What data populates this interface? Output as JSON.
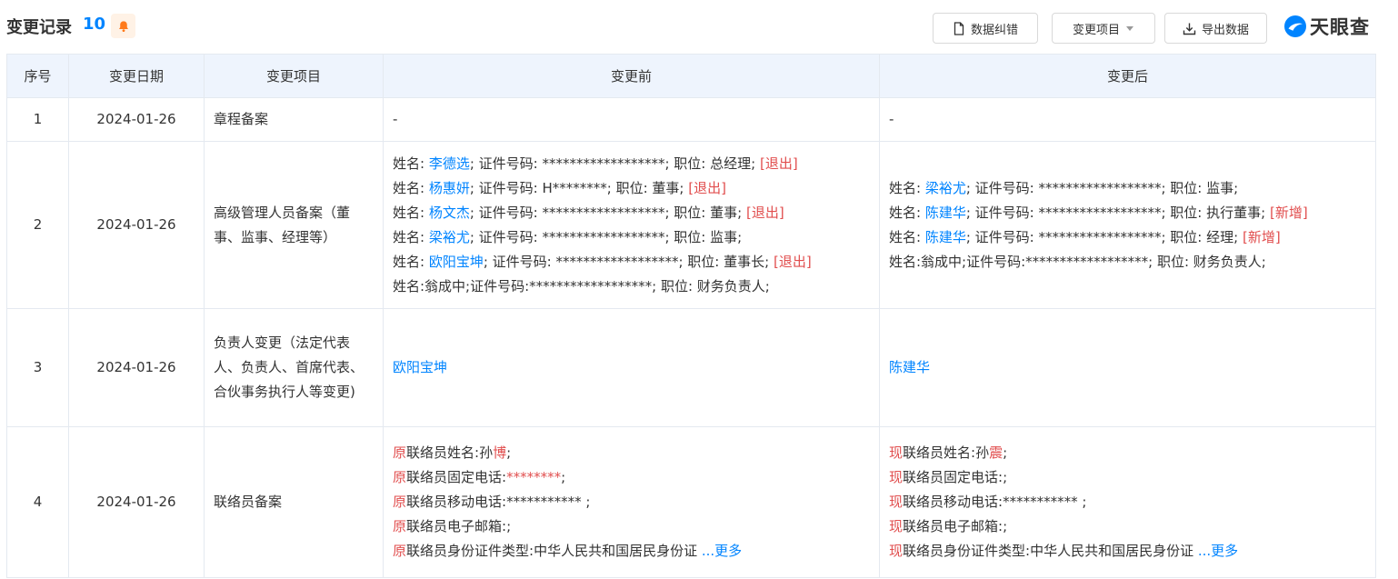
{
  "header": {
    "title": "变更记录",
    "count": "10",
    "btn_fix": "数据纠错",
    "btn_filter": "变更项目",
    "btn_export": "导出数据",
    "logo": "天眼查"
  },
  "colors": {
    "accent": "#0084ff",
    "red": "#e14e4e",
    "header_bg": "#eef4fd",
    "bell_bg": "#fff2e6",
    "bell": "#ff7a1a"
  },
  "columns": [
    "序号",
    "变更日期",
    "变更项目",
    "变更前",
    "变更后"
  ],
  "rows": [
    {
      "num": "1",
      "date": "2024-01-26",
      "item": "章程备案",
      "before": "-",
      "after": "-"
    },
    {
      "num": "2",
      "date": "2024-01-26",
      "item": "高级管理人员备案（董事、监事、经理等）",
      "before": [
        {
          "p1": "姓名: ",
          "name": "李德选",
          "p2": "; 证件号码: ******************; 职位: 总经理; ",
          "tag": "[退出]"
        },
        {
          "p1": "姓名: ",
          "name": "杨惠妍",
          "p2": "; 证件号码: H********; 职位: 董事; ",
          "tag": "[退出]"
        },
        {
          "p1": "姓名: ",
          "name": "杨文杰",
          "p2": "; 证件号码: ******************; 职位: 董事; ",
          "tag": "[退出]"
        },
        {
          "p1": "姓名: ",
          "name": "梁裕尤",
          "p2": "; 证件号码: ******************; 职位: 监事;",
          "tag": ""
        },
        {
          "p1": "姓名: ",
          "name": "欧阳宝坤",
          "p2": "; 证件号码: ******************; 职位: 董事长; ",
          "tag": "[退出]"
        },
        {
          "p1": "姓名:翁成中;证件号码:******************; 职位: 财务负责人;",
          "name": "",
          "p2": "",
          "tag": ""
        }
      ],
      "after": [
        {
          "p1": "姓名: ",
          "name": "梁裕尤",
          "p2": "; 证件号码: ******************; 职位: 监事;",
          "tag": ""
        },
        {
          "p1": "姓名: ",
          "name": "陈建华",
          "p2": "; 证件号码: ******************; 职位: 执行董事; ",
          "tag": "[新增]"
        },
        {
          "p1": "姓名: ",
          "name": "陈建华",
          "p2": "; 证件号码: ******************; 职位: 经理; ",
          "tag": "[新增]"
        },
        {
          "p1": "姓名:翁成中;证件号码:******************; 职位: 财务负责人;",
          "name": "",
          "p2": "",
          "tag": ""
        }
      ]
    },
    {
      "num": "3",
      "date": "2024-01-26",
      "item": "负责人变更（法定代表人、负责人、首席代表、合伙事务执行人等变更)",
      "before": "欧阳宝坤",
      "after": "陈建华"
    },
    {
      "num": "4",
      "date": "2024-01-26",
      "item": "联络员备案",
      "before": [
        {
          "prefix": "原",
          "text": "联络员姓名:孙",
          "hl": "博",
          "rest": ";"
        },
        {
          "prefix": "原",
          "text": "联络员固定电话:",
          "hl": "********",
          "rest": ";"
        },
        {
          "prefix": "原",
          "text": "联络员移动电话:*********** ;",
          "hl": "",
          "rest": ""
        },
        {
          "prefix": "原",
          "text": "联络员电子邮箱:;",
          "hl": "",
          "rest": ""
        },
        {
          "prefix": "原",
          "text": "联络员身份证件类型:中华人民共和国居民身份证",
          "hl": "",
          "rest": ""
        }
      ],
      "after": [
        {
          "prefix": "现",
          "text": "联络员姓名:孙",
          "hl": "震",
          "rest": ";"
        },
        {
          "prefix": "现",
          "text": "联络员固定电话:;",
          "hl": "",
          "rest": ""
        },
        {
          "prefix": "现",
          "text": "联络员移动电话:*********** ;",
          "hl": "",
          "rest": ""
        },
        {
          "prefix": "现",
          "text": "联络员电子邮箱:;",
          "hl": "",
          "rest": ""
        },
        {
          "prefix": "现",
          "text": "联络员身份证件类型:中华人民共和国居民身份证",
          "hl": "",
          "rest": ""
        }
      ],
      "more": "...更多"
    }
  ]
}
